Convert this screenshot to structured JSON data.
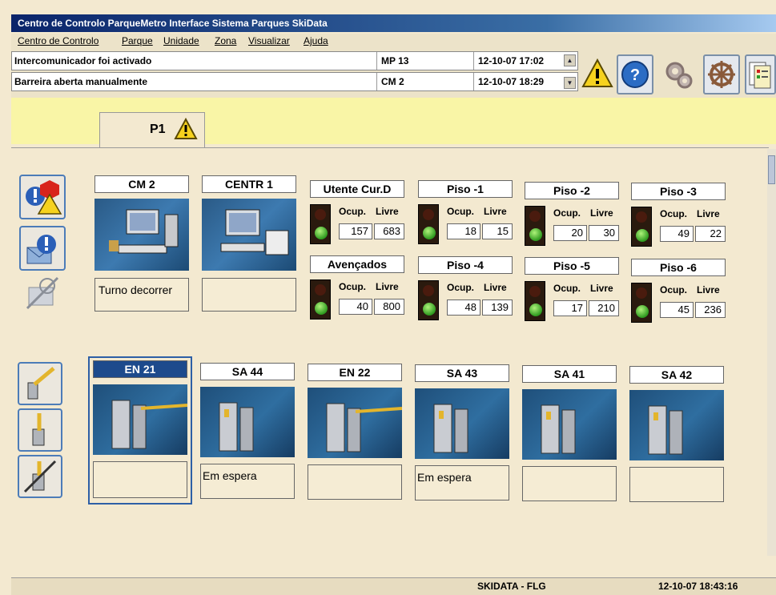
{
  "window": {
    "title": "Centro de Controlo  ParqueMetro Interface  Sistema Parques SkiData"
  },
  "menu": [
    "Centro de Controlo",
    "Parque",
    "Unidade",
    "Zona",
    "Visualizar",
    "Ajuda"
  ],
  "alarms": [
    {
      "message": "Intercomunicador foi activado",
      "unit": "MP 13",
      "time": "12-10-07 17:02"
    },
    {
      "message": "Barreira aberta manualmente",
      "unit": "CM 2",
      "time": "12-10-07 18:29"
    }
  ],
  "toolbar": [
    "warning-icon",
    "help-icon",
    "settings-icon",
    "control-icon",
    "reports-icon"
  ],
  "tab": {
    "label": "P1"
  },
  "terminals": [
    {
      "name": "CM 2",
      "status": "Turno decorrer"
    },
    {
      "name": "CENTR 1",
      "status": ""
    }
  ],
  "counter_headers": {
    "ocup": "Ocup.",
    "livre": "Livre"
  },
  "counters": [
    {
      "name": "Utente Cur.D",
      "ocup": "157",
      "livre": "683"
    },
    {
      "name": "Piso -1",
      "ocup": "18",
      "livre": "15"
    },
    {
      "name": "Piso -2",
      "ocup": "20",
      "livre": "30"
    },
    {
      "name": "Piso -3",
      "ocup": "49",
      "livre": "22"
    },
    {
      "name": "Avençados",
      "ocup": "40",
      "livre": "800"
    },
    {
      "name": "Piso -4",
      "ocup": "48",
      "livre": "139"
    },
    {
      "name": "Piso -5",
      "ocup": "17",
      "livre": "210"
    },
    {
      "name": "Piso -6",
      "ocup": "45",
      "livre": "236"
    }
  ],
  "barriers": [
    {
      "name": "EN 21",
      "status": "",
      "selected": true
    },
    {
      "name": "SA 44",
      "status": "Em espera",
      "selected": false
    },
    {
      "name": "EN 22",
      "status": "",
      "selected": false
    },
    {
      "name": "SA 43",
      "status": "Em espera",
      "selected": false
    },
    {
      "name": "SA 41",
      "status": "",
      "selected": false
    },
    {
      "name": "SA 42",
      "status": "",
      "selected": false
    }
  ],
  "statusbar": {
    "system": "SKIDATA - FLG",
    "clock": "12-10-07 18:43:16"
  }
}
